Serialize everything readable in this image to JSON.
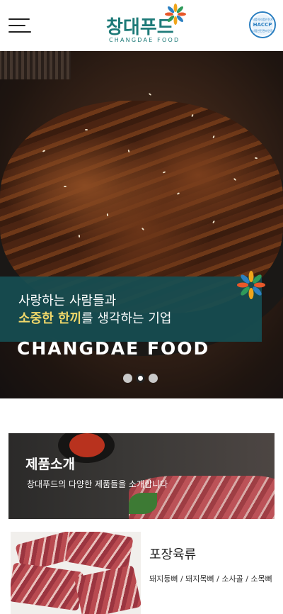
{
  "header": {
    "logo_kr": "창대푸드",
    "logo_en": "CHANGDAE FOOD",
    "haccp_top": "식품의약품안전처",
    "haccp_label": "HACCP",
    "haccp_bottom": "식품안전관리인증"
  },
  "hero": {
    "line1": "사랑하는 사람들과",
    "line2_highlight": "소중한 한끼",
    "line2_rest": "를 생각하는 기업",
    "brand": "CHANGDAE FOOD",
    "slide_count": 3,
    "active_slide": 2
  },
  "intro": {
    "title": "제품소개",
    "description": "창대푸드의 다양한 제품들을 소개합니다"
  },
  "product": {
    "title": "포장육류",
    "subtitle": "돼지등뼈 / 돼지목뼈 / 소사골 / 소목뼈"
  },
  "colors": {
    "brand_teal": "#1d7a78",
    "band": "#164e52",
    "highlight": "#f1d86a"
  }
}
